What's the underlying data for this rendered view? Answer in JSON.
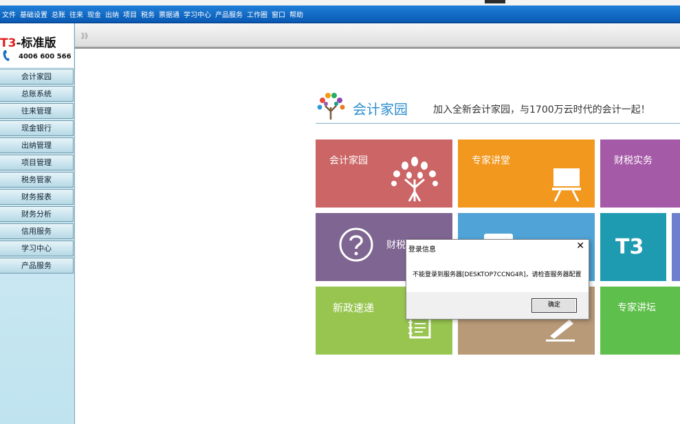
{
  "menu": [
    "文件",
    "基础设置",
    "总账",
    "往来",
    "现金",
    "出纳",
    "项目",
    "税务",
    "票据通",
    "学习中心",
    "产品服务",
    "工作圈",
    "窗口",
    "帮助"
  ],
  "brand": {
    "prefix": "T3",
    "suffix": "-标准版",
    "phone": "4006 600 566"
  },
  "sidebar": [
    "会计家园",
    "总账系统",
    "往来管理",
    "现金银行",
    "出纳管理",
    "项目管理",
    "税务管家",
    "财务报表",
    "财务分析",
    "信用服务",
    "学习中心",
    "产品服务"
  ],
  "toolbar": {
    "arrows": "》》"
  },
  "portal": {
    "name": "会计家园",
    "slogan": "加入全新会计家园，与1700万云时代的会计一起！"
  },
  "tiles": {
    "t1": "会计家园",
    "t2": "专家讲堂",
    "t3": "财税实务",
    "t4": "财税",
    "t5": "T3",
    "t6": "新政速递",
    "t7": "专家讲坛"
  },
  "colors": {
    "red": "#cc6565",
    "orange": "#f3981f",
    "purple": "#a55aa7",
    "violet": "#7f6591",
    "blue": "#4fa3d6",
    "teal": "#1e9bb0",
    "green": "#98c54f",
    "tan": "#b89a78",
    "leaf": "#5fbf4c"
  },
  "dialog": {
    "title": "登录信息",
    "close": "✕",
    "message": "不能登录到服务器[DESKTOP7CCNG4R]，请检查服务器配置",
    "ok": "确定"
  }
}
